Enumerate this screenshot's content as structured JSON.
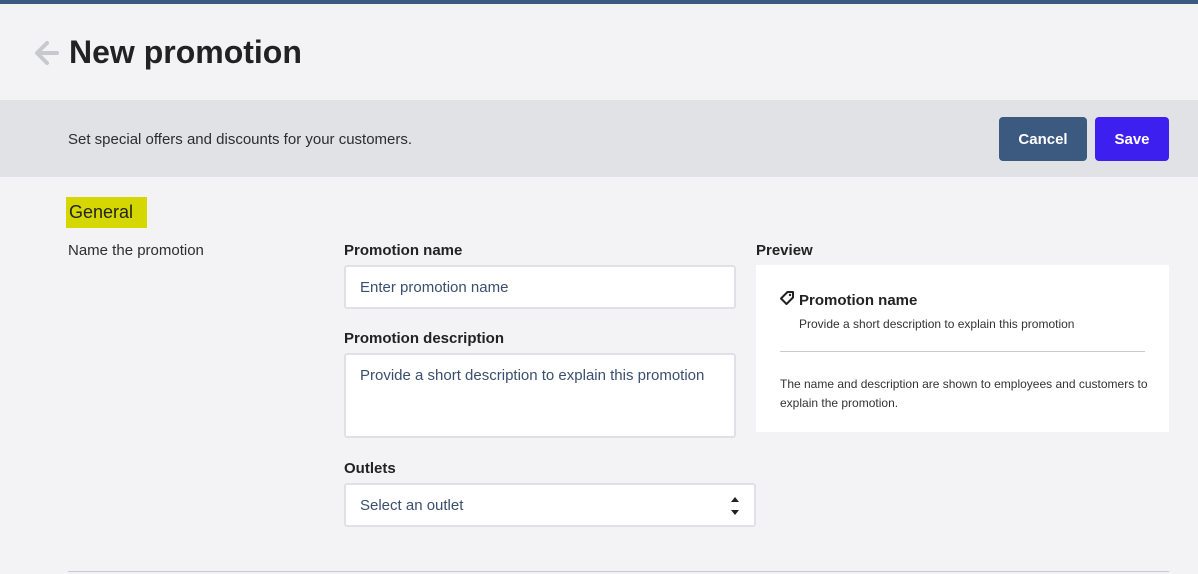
{
  "header": {
    "title": "New promotion",
    "back_icon": "arrow-left-icon"
  },
  "banner": {
    "description": "Set special offers and discounts for your customers.",
    "cancel_label": "Cancel",
    "save_label": "Save"
  },
  "section": {
    "title": "General",
    "subtitle": "Name the promotion"
  },
  "form": {
    "name_label": "Promotion name",
    "name_placeholder": "Enter promotion name",
    "name_value": "",
    "description_label": "Promotion description",
    "description_placeholder": "Provide a short description to explain this promotion",
    "description_value": "",
    "outlets_label": "Outlets",
    "outlets_selected": "Select an outlet"
  },
  "preview": {
    "label": "Preview",
    "icon": "tag-icon",
    "title": "Promotion name",
    "description": "Provide a short description to explain this promotion",
    "note": "The name and description are shown to employees and customers to explain the promotion."
  },
  "colors": {
    "top_bar": "#3a5a82",
    "cancel_button": "#3c5a80",
    "save_button": "#3d1ff0",
    "section_highlight": "#d4d800",
    "banner_bg": "#e1e2e6",
    "page_bg": "#f3f3f6"
  }
}
